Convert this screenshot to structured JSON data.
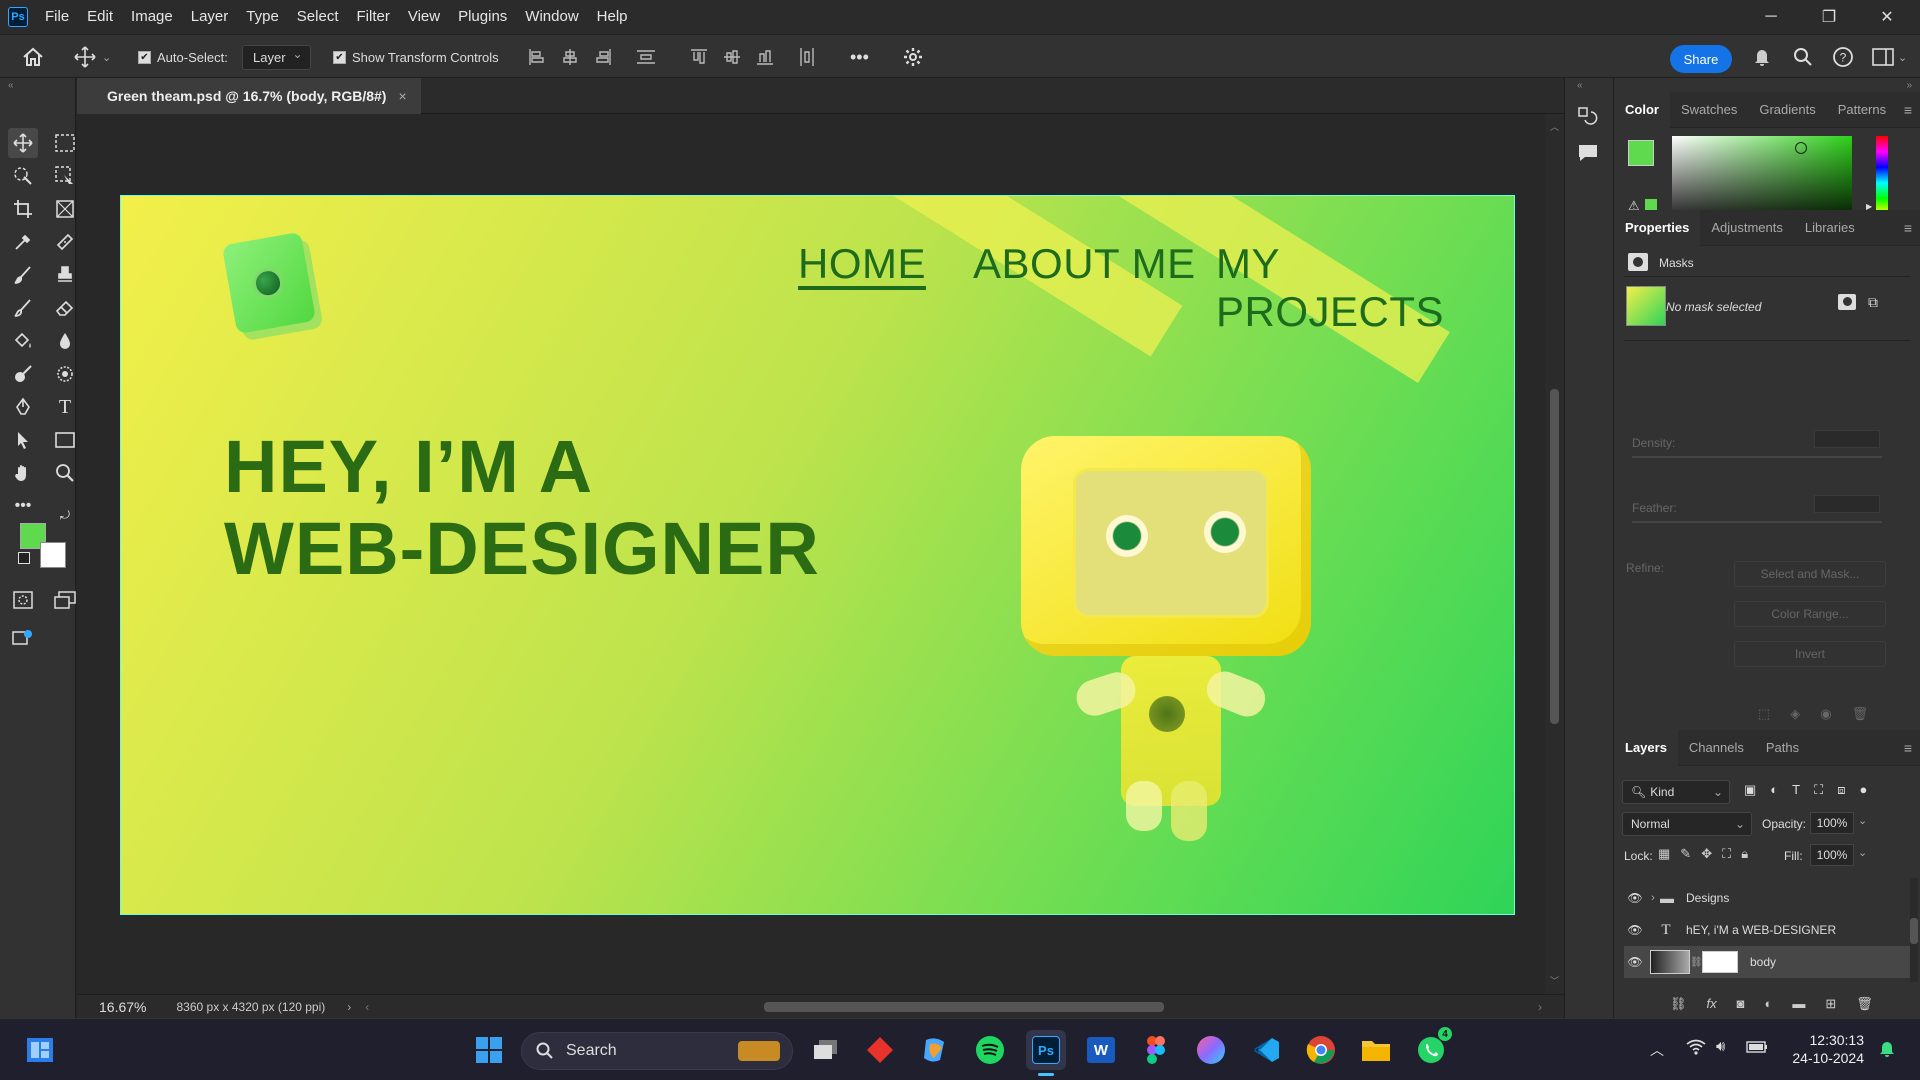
{
  "menubar": {
    "app_logo": "Ps",
    "items": [
      "File",
      "Edit",
      "Image",
      "Layer",
      "Type",
      "Select",
      "Filter",
      "View",
      "Plugins",
      "Window",
      "Help"
    ]
  },
  "options": {
    "auto_select_label": "Auto-Select:",
    "auto_select_value": "Layer",
    "transform_label": "Show Transform Controls",
    "share_label": "Share"
  },
  "document": {
    "tab_title": "Green theam.psd @ 16.7% (body, RGB/8#)",
    "zoom": "16.67%",
    "dimensions": "8360 px x 4320 px (120 ppi)"
  },
  "artboard": {
    "nav": [
      "HOME",
      "ABOUT ME",
      "MY PROJECTS"
    ],
    "hero_line1": "HEY, I’M A",
    "hero_line2": "WEB-DESIGNER"
  },
  "color_panel": {
    "tabs": [
      "Color",
      "Swatches",
      "Gradients",
      "Patterns"
    ],
    "foreground": "#5fd94e",
    "background": "#ffffff"
  },
  "properties_panel": {
    "tabs": [
      "Properties",
      "Adjustments",
      "Libraries"
    ],
    "section": "Masks",
    "mask_status": "No mask selected",
    "density_label": "Density:",
    "feather_label": "Feather:",
    "refine_label": "Refine:",
    "buttons": [
      "Select and Mask...",
      "Color Range...",
      "Invert"
    ]
  },
  "layers_panel": {
    "tabs": [
      "Layers",
      "Channels",
      "Paths"
    ],
    "filter_kind": "Kind",
    "blend_mode": "Normal",
    "opacity_label": "Opacity:",
    "opacity": "100%",
    "lock_label": "Lock:",
    "fill_label": "Fill:",
    "fill": "100%",
    "layers": [
      {
        "name": "Designs",
        "type": "group"
      },
      {
        "name": "hEY, i'M a WEB-DESIGNER",
        "type": "text"
      },
      {
        "name": "body",
        "type": "pixel"
      }
    ]
  },
  "taskbar": {
    "search_placeholder": "Search",
    "time": "12:30:13",
    "date": "24-10-2024",
    "whatsapp_badge": "4"
  }
}
